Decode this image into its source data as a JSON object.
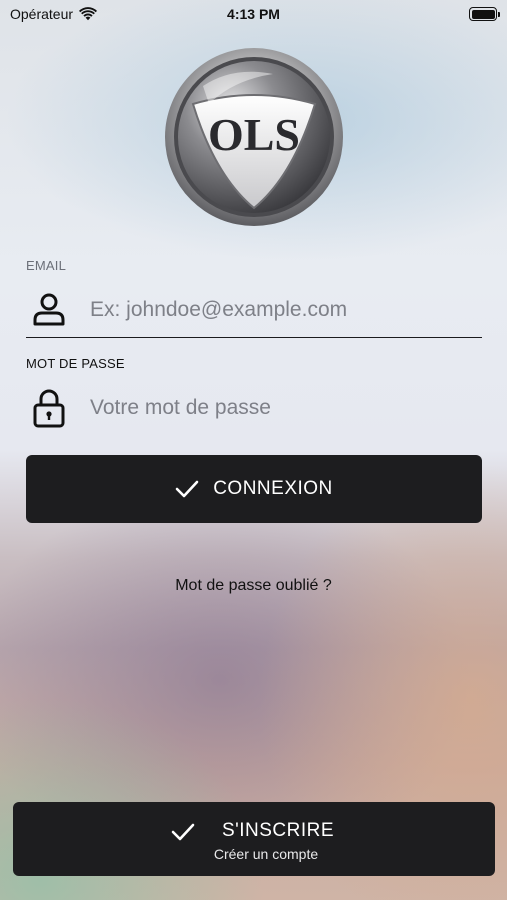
{
  "status_bar": {
    "carrier": "Opérateur",
    "time": "4:13 PM",
    "battery_level": 1.0
  },
  "logo": {
    "text": "OLS"
  },
  "form": {
    "email_label": "EMAIL",
    "email_placeholder": "Ex: johndoe@example.com",
    "email_value": "",
    "password_label": "MOT DE PASSE",
    "password_placeholder": "Votre mot de passe",
    "password_value": ""
  },
  "actions": {
    "login_label": "CONNEXION",
    "forgot_password_label": "Mot de passe oublié ?",
    "register_label": "S'INSCRIRE",
    "register_sublabel": "Créer un compte"
  },
  "icons": {
    "wifi": "wifi-icon",
    "battery": "battery-icon",
    "user": "user-icon",
    "lock": "lock-icon",
    "check": "checkmark-icon"
  },
  "colors": {
    "button_bg": "#1d1d1f",
    "button_text": "#ffffff",
    "placeholder": "#7e8088"
  }
}
